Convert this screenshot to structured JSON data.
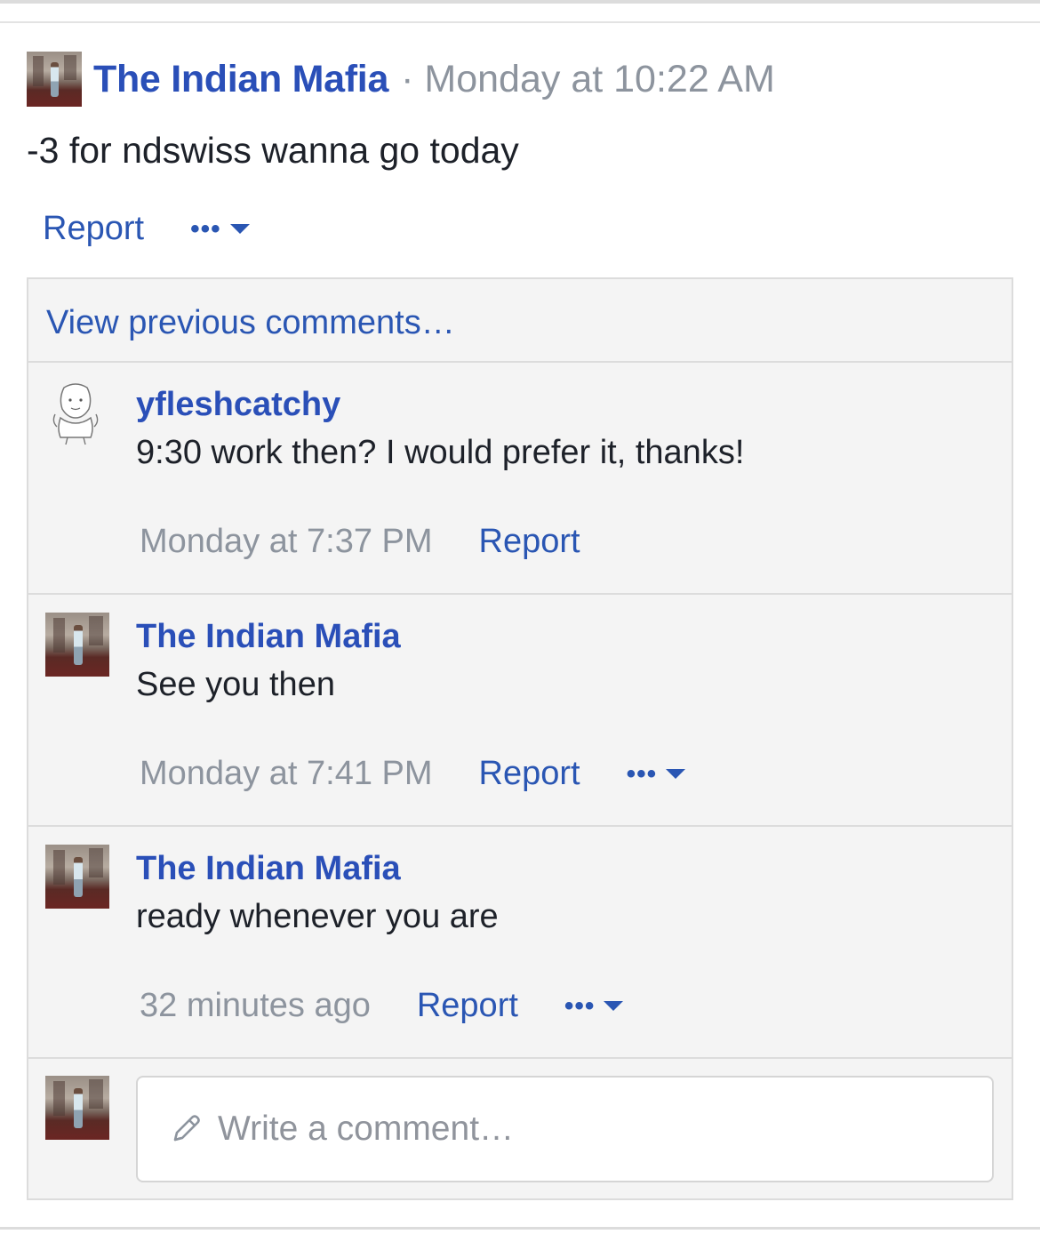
{
  "post": {
    "author": "The Indian Mafia",
    "separator": "·",
    "time": "Monday at 10:22 AM",
    "text": "-3 for ndswiss wanna go today",
    "report_label": "Report",
    "more_label": "•••"
  },
  "comments": {
    "view_previous": "View previous comments…",
    "items": [
      {
        "author": "yfleshcatchy",
        "text": "9:30 work then? I would prefer it, thanks!",
        "time": "Monday at 7:37 PM",
        "report_label": "Report"
      },
      {
        "author": "The Indian Mafia",
        "text": "See you then",
        "time": "Monday at 7:41 PM",
        "report_label": "Report",
        "more_label": "•••"
      },
      {
        "author": "The Indian Mafia",
        "text": "ready whenever you are",
        "time": "32 minutes ago",
        "report_label": "Report",
        "more_label": "•••"
      }
    ],
    "write_placeholder": "Write a comment…"
  },
  "icons": {
    "more": "ellipsis-icon",
    "dropdown": "caret-down-icon",
    "compose": "pencil-icon"
  },
  "colors": {
    "link": "#2a56b3",
    "name": "#2a4fb8",
    "muted": "#8d949e",
    "panel": "#f4f4f4"
  }
}
